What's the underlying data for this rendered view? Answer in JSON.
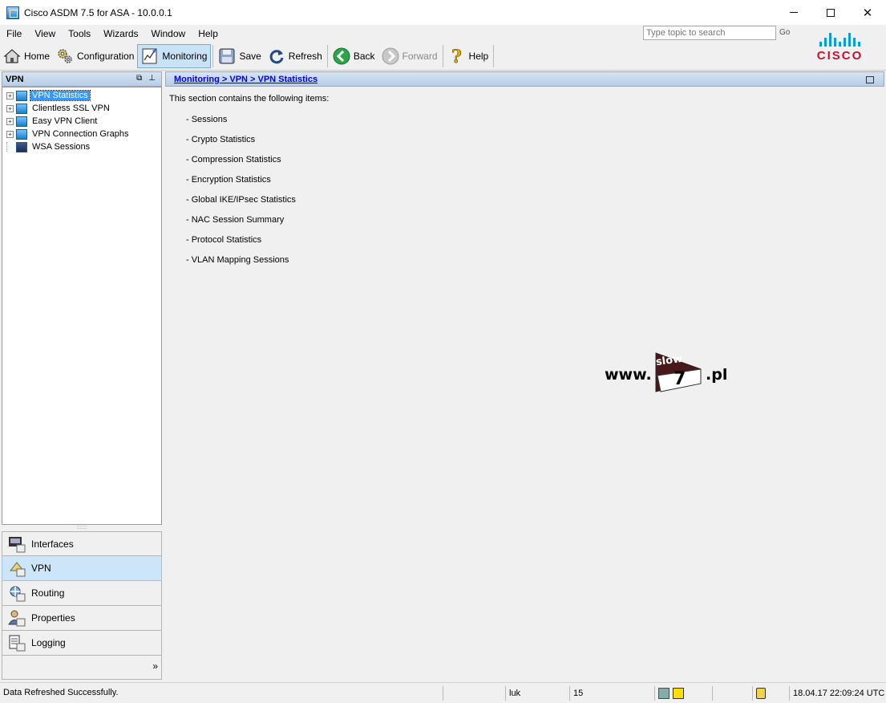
{
  "window": {
    "title": "Cisco ASDM 7.5 for ASA - 10.0.0.1",
    "minimize": "minimize",
    "maximize": "maximize",
    "close": "✕"
  },
  "menu": [
    "File",
    "View",
    "Tools",
    "Wizards",
    "Window",
    "Help"
  ],
  "help_search": {
    "placeholder": "Type topic to search",
    "go_label": "Go"
  },
  "logo": {
    "wordmark": "CISCO",
    "color_primary": "#c8102e",
    "color_bars": "#049fd9"
  },
  "toolbar": {
    "home": "Home",
    "configuration": "Configuration",
    "monitoring": "Monitoring",
    "save": "Save",
    "refresh": "Refresh",
    "back": "Back",
    "forward": "Forward",
    "help": "Help"
  },
  "left_panel": {
    "title": "VPN",
    "tree": [
      {
        "label": "VPN Statistics",
        "expandable": true,
        "selected": true
      },
      {
        "label": "Clientless SSL VPN",
        "expandable": true,
        "selected": false
      },
      {
        "label": "Easy VPN Client",
        "expandable": true,
        "selected": false
      },
      {
        "label": "VPN Connection Graphs",
        "expandable": true,
        "selected": false
      },
      {
        "label": "WSA Sessions",
        "expandable": false,
        "selected": false
      }
    ],
    "nav": [
      {
        "label": "Interfaces",
        "active": false
      },
      {
        "label": "VPN",
        "active": true
      },
      {
        "label": "Routing",
        "active": false
      },
      {
        "label": "Properties",
        "active": false
      },
      {
        "label": "Logging",
        "active": false
      }
    ],
    "more": "»"
  },
  "content": {
    "breadcrumb": "Monitoring > VPN > VPN Statistics",
    "intro": "This section contains the following items:",
    "items": [
      "- Sessions",
      "- Crypto Statistics",
      "- Compression Statistics",
      "- Encryption Statistics",
      "- Global IKE/IPsec Statistics",
      "- NAC Session Summary",
      "- Protocol Statistics",
      "- VLAN Mapping Sessions"
    ]
  },
  "watermark": {
    "prefix": "www.",
    "flag_top": "slow",
    "flag_number": "7",
    "suffix": ".pl"
  },
  "statusbar": {
    "message": "Data Refreshed Successfully.",
    "user": "luk",
    "privilege": "15",
    "datetime": "18.04.17 22:09:24 UTC"
  }
}
